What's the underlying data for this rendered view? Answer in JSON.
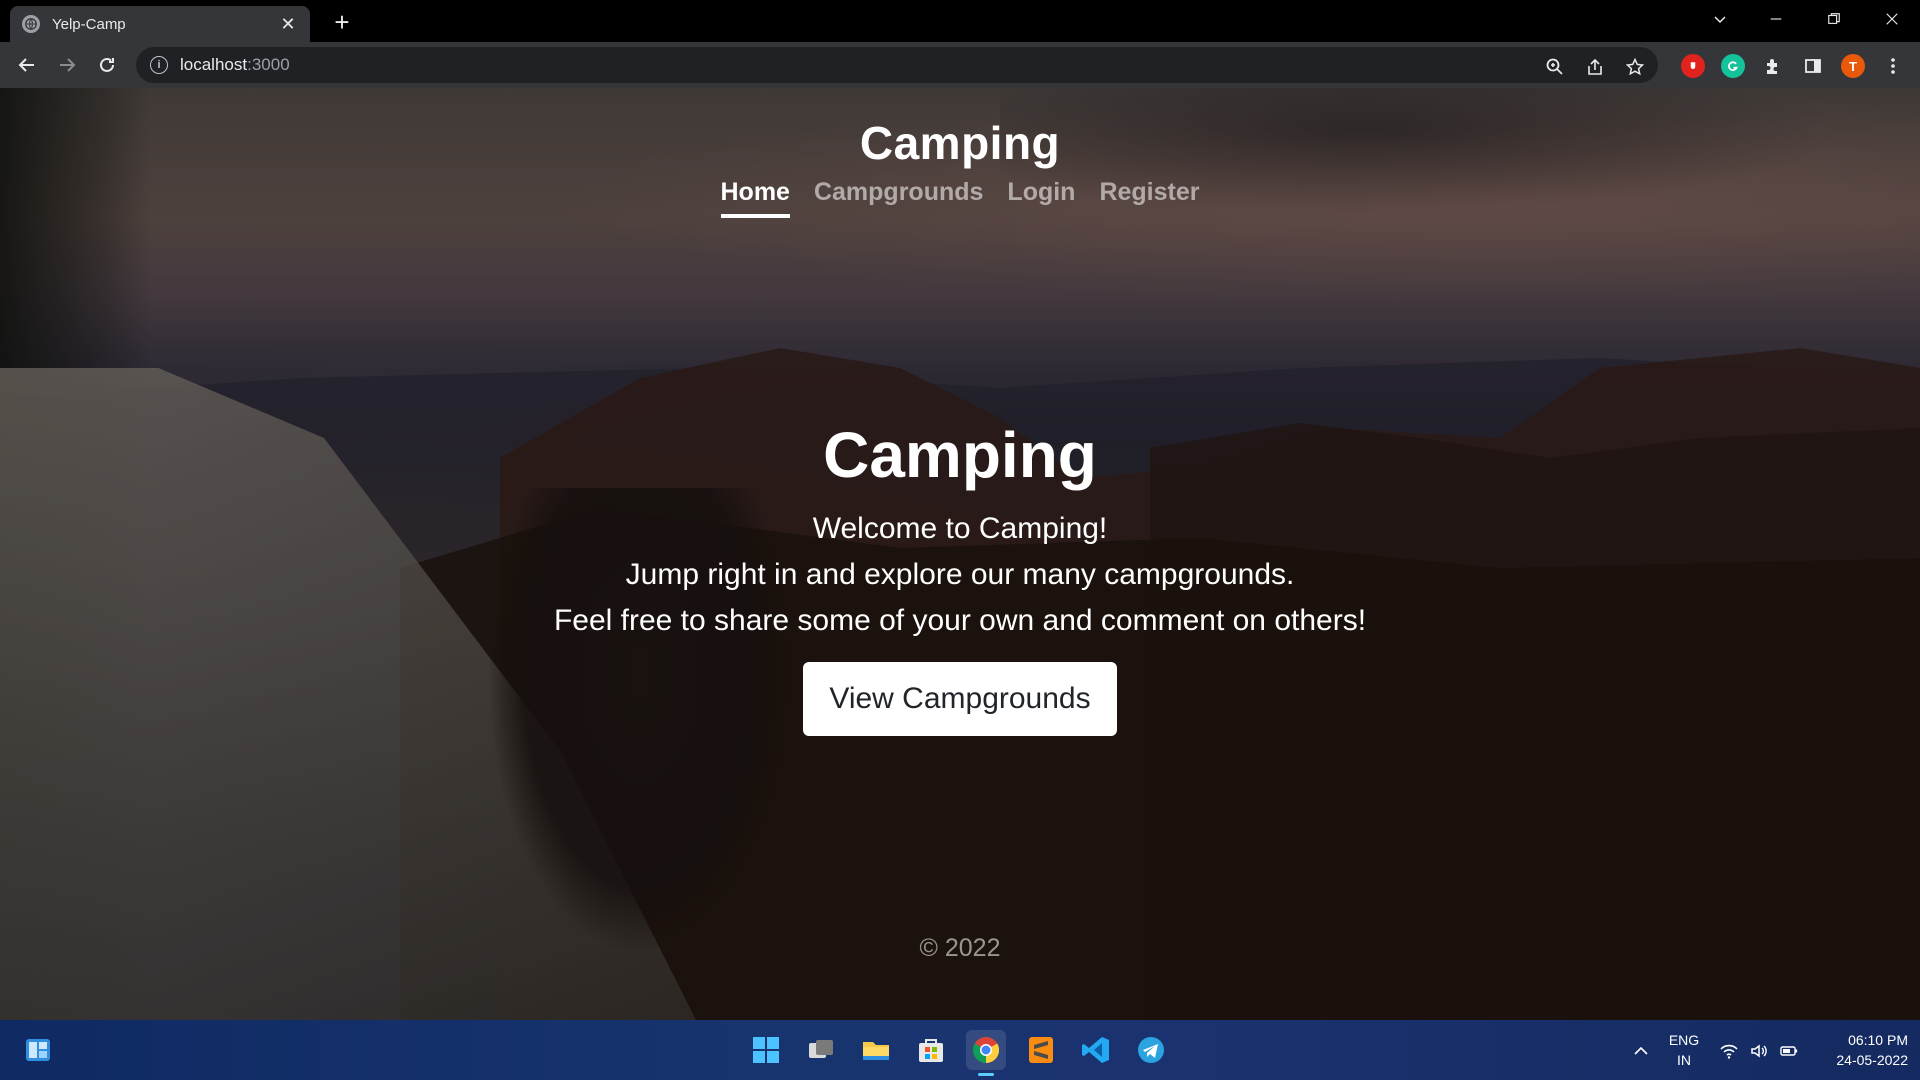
{
  "browser": {
    "tab_title": "Yelp-Camp",
    "tab_close": "✕",
    "new_tab": "+",
    "url_host": "localhost",
    "url_port": ":3000",
    "profile_initial": "T"
  },
  "page": {
    "brand": "Camping",
    "nav": {
      "home": "Home",
      "campgrounds": "Campgrounds",
      "login": "Login",
      "register": "Register"
    },
    "hero": {
      "title": "Camping",
      "lines": [
        "Welcome to Camping!",
        "Jump right in and explore our many campgrounds.",
        "Feel free to share some of your own and comment on others!"
      ],
      "cta": "View Campgrounds"
    },
    "footer": "© 2022"
  },
  "taskbar": {
    "language": "ENG",
    "region": "IN",
    "time": "06:10 PM",
    "date": "24-05-2022"
  }
}
